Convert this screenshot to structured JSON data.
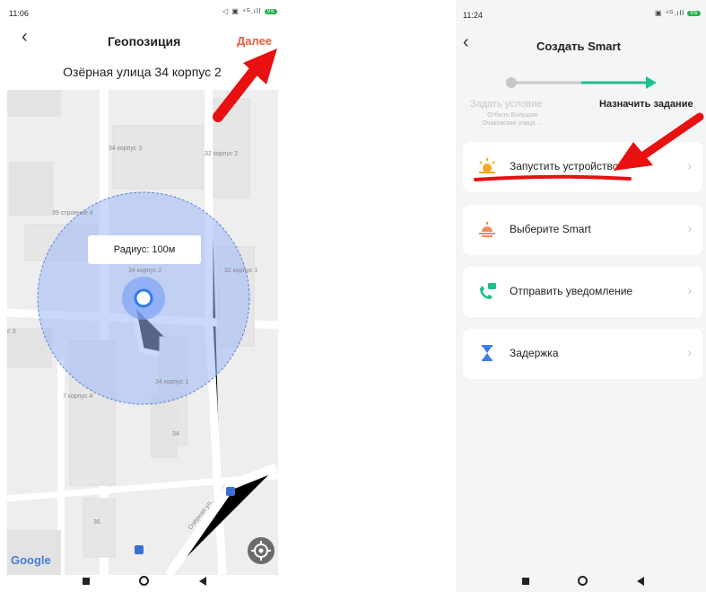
{
  "left_screen": {
    "status_time": "11:06",
    "status_icons": "◁ ▣ ⁴ᴳ.ıll",
    "battery": "96",
    "header_title": "Геопозиция",
    "next_button": "Далее",
    "address": "Озёрная улица 34 корпус 2",
    "radius_label": "Радиус: 100м",
    "map_labels": {
      "b1": "34 корпус 3",
      "b2": "32 корпус 2",
      "b3": "39 строение 4",
      "b4": "34 корпус 2",
      "b5": "32 корпус 1",
      "b6": "с 3",
      "b7": "7 корпус 4",
      "b8": "34 корпус 1",
      "b9": "34",
      "b10": "36",
      "street": "Озёрная ул."
    },
    "google_logo": "Google"
  },
  "right_screen": {
    "status_time": "11:24",
    "status_icons": "▣ ⁴ᴳ.ıll",
    "battery": "96",
    "header_title": "Создать Smart",
    "steps": [
      {
        "label": "Задать условие",
        "sublabel_1": "Отбыть Большая",
        "sublabel_2": "Очаковская улица ..."
      },
      {
        "label": "Назначить задание"
      }
    ],
    "actions": [
      {
        "label": "Запустить устройство",
        "icon": "sun-icon"
      },
      {
        "label": "Выберите Smart",
        "icon": "sunrise-icon"
      },
      {
        "label": "Отправить уведомление",
        "icon": "phone-message-icon"
      },
      {
        "label": "Задержка",
        "icon": "hourglass-icon"
      }
    ],
    "chevron": "›"
  },
  "colors": {
    "accent_orange": "#e85d3b",
    "teal": "#1fbf8f",
    "annotation_red": "#e81010",
    "geofence_fill": "#9db8f7",
    "marker_blue": "#2f7df0"
  }
}
